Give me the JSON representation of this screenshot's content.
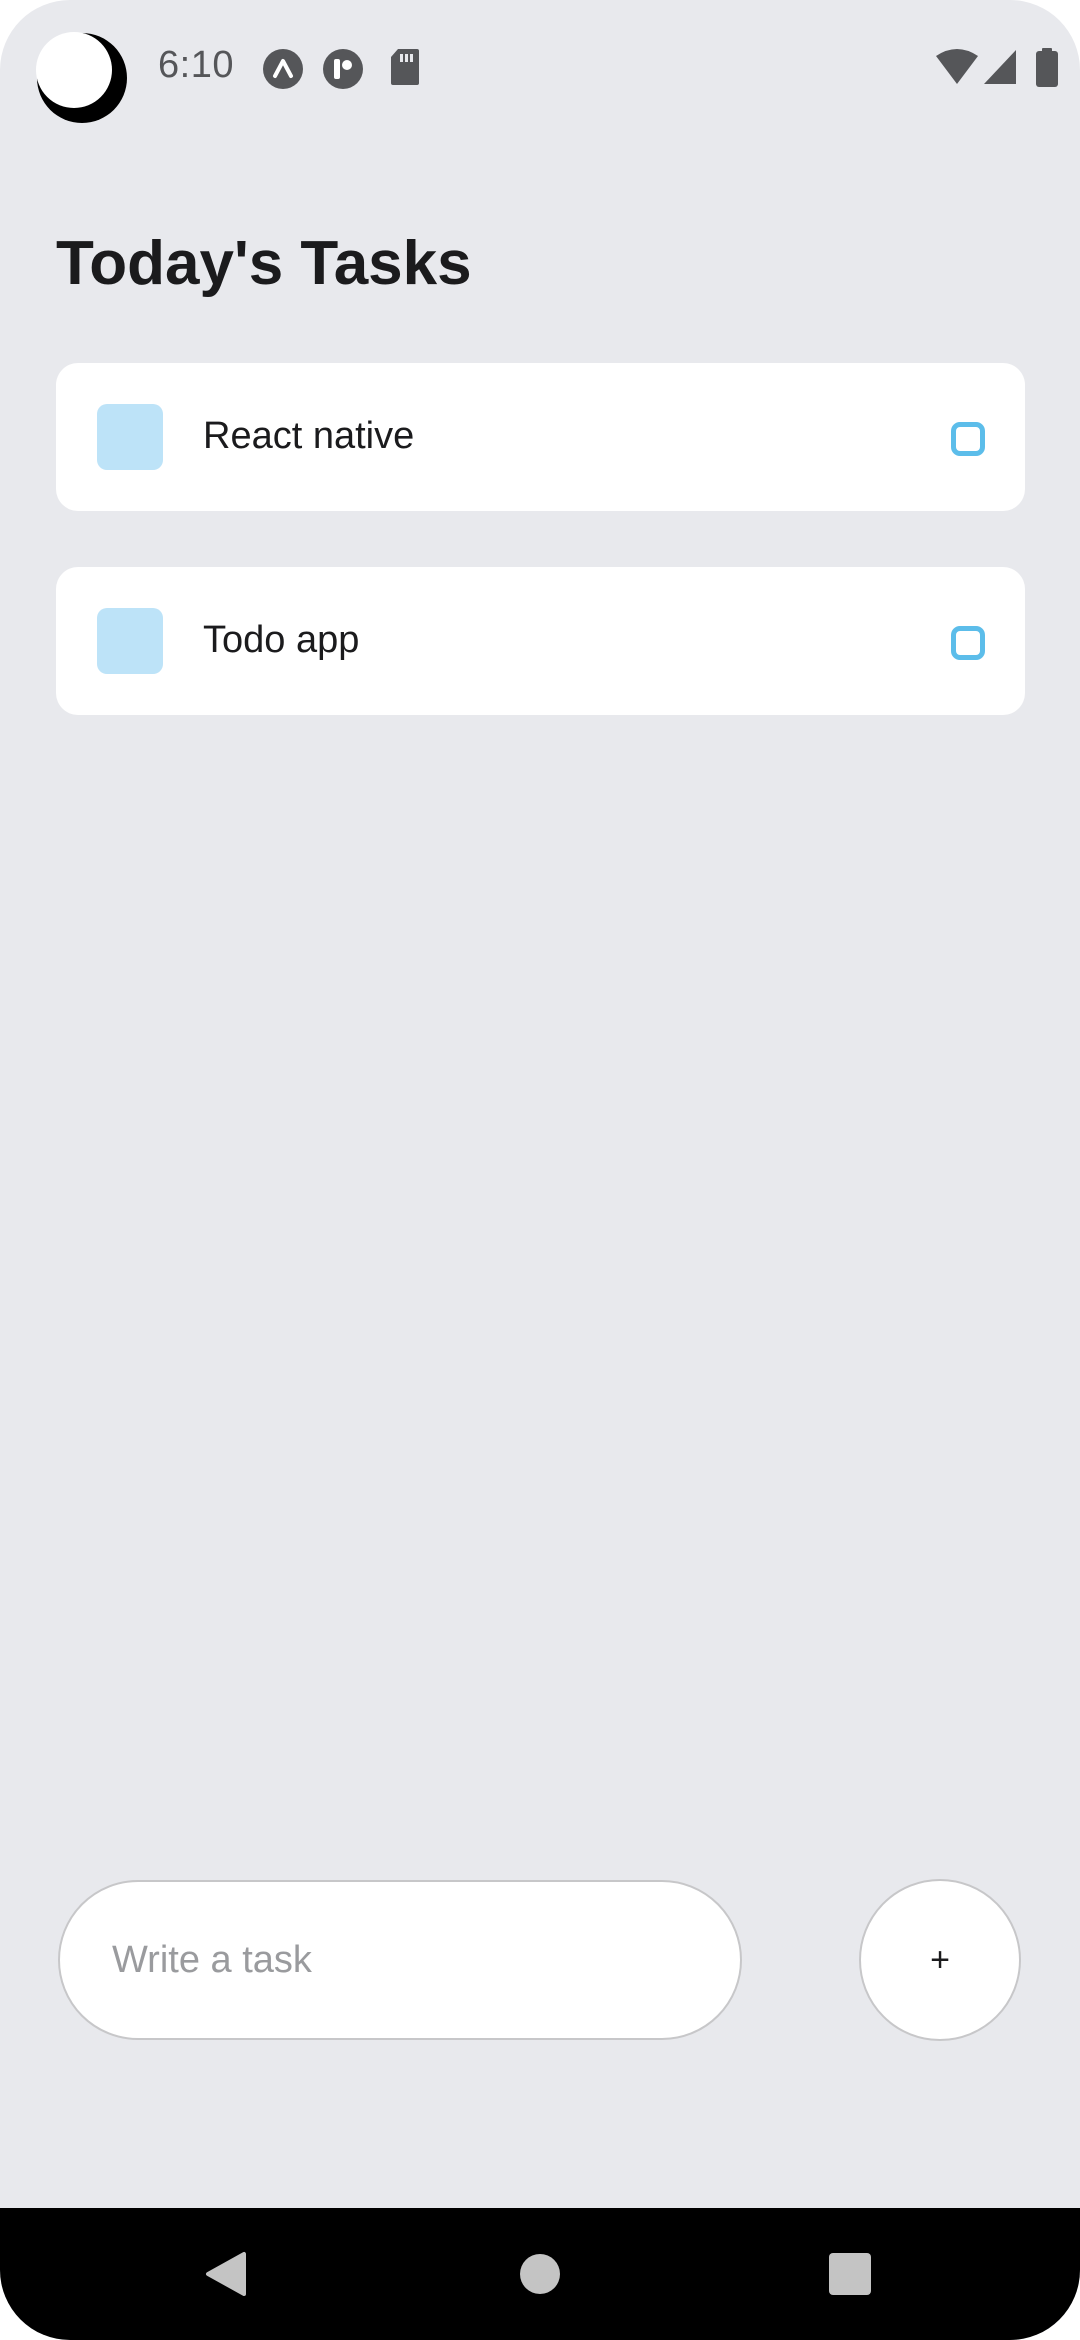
{
  "status_bar": {
    "time": "6:10",
    "notification_icons": [
      "app-a-icon",
      "app-t-icon",
      "sd-card-icon"
    ],
    "system_icons": [
      "wifi-icon",
      "signal-icon",
      "battery-icon"
    ]
  },
  "page": {
    "title": "Today's Tasks"
  },
  "tasks": [
    {
      "text": "React native"
    },
    {
      "text": "Todo app"
    }
  ],
  "input": {
    "placeholder": "Write a task",
    "value": ""
  },
  "add_button": {
    "label": "+"
  },
  "colors": {
    "background": "#e8e9ed",
    "card": "#ffffff",
    "task_square": "#bde3f8",
    "task_circle": "#5cbdea",
    "title_text": "#1b1b1d"
  },
  "nav_bar": {
    "buttons": [
      "back-icon",
      "home-icon",
      "recents-icon"
    ]
  }
}
